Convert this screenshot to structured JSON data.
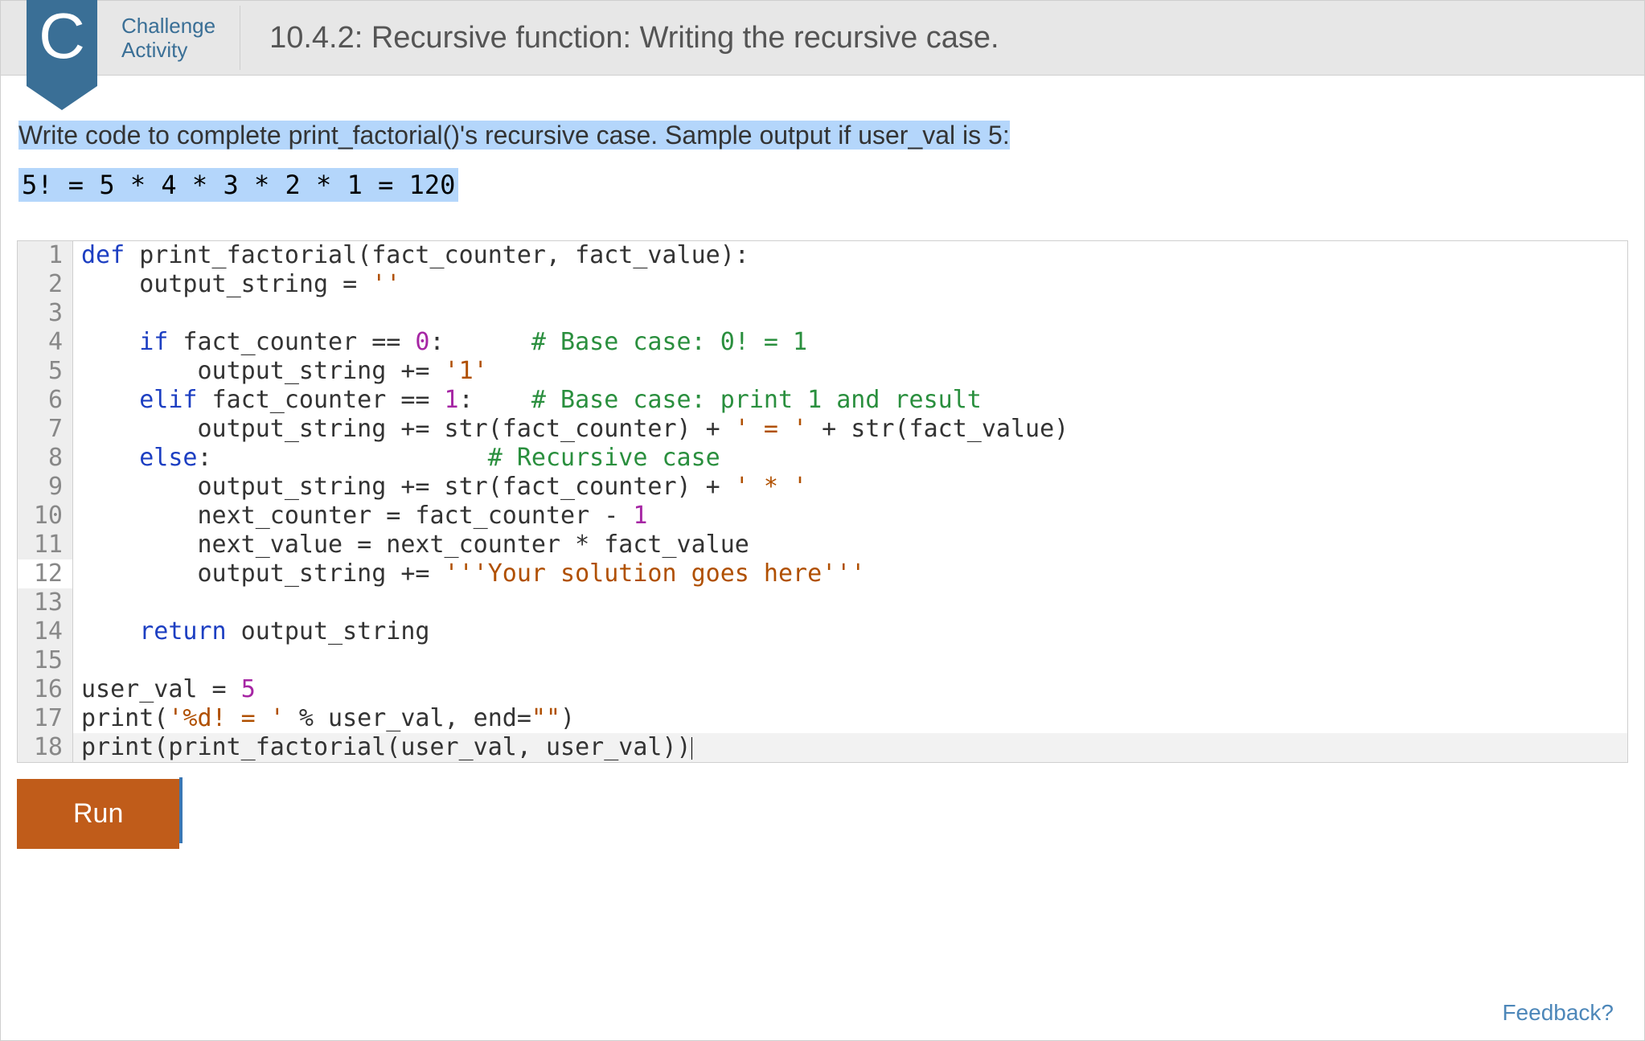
{
  "header": {
    "badge_letter": "C",
    "challenge_line1": "Challenge",
    "challenge_line2": "Activity",
    "title": "10.4.2: Recursive function: Writing the recursive case."
  },
  "instruction": {
    "text": "Write code to complete print_factorial()'s recursive case. Sample output if user_val is 5:",
    "sample_output": "5! = 5 * 4 * 3 * 2 * 1 = 120"
  },
  "code": {
    "lines": [
      {
        "n": 1,
        "tokens": [
          [
            "kw",
            "def"
          ],
          [
            "",
            " "
          ],
          [
            "fn",
            "print_factorial"
          ],
          [
            "",
            "(fact_counter, fact_value):"
          ]
        ]
      },
      {
        "n": 2,
        "tokens": [
          [
            "",
            "    output_string = "
          ],
          [
            "str",
            "''"
          ]
        ]
      },
      {
        "n": 3,
        "tokens": [
          [
            "",
            ""
          ]
        ]
      },
      {
        "n": 4,
        "tokens": [
          [
            "",
            "    "
          ],
          [
            "kw",
            "if"
          ],
          [
            "",
            " fact_counter == "
          ],
          [
            "num",
            "0"
          ],
          [
            "",
            ":      "
          ],
          [
            "com",
            "# Base case: 0! = 1"
          ]
        ]
      },
      {
        "n": 5,
        "tokens": [
          [
            "",
            "        output_string += "
          ],
          [
            "str",
            "'1'"
          ]
        ]
      },
      {
        "n": 6,
        "tokens": [
          [
            "",
            "    "
          ],
          [
            "kw",
            "elif"
          ],
          [
            "",
            " fact_counter == "
          ],
          [
            "num",
            "1"
          ],
          [
            "",
            ":    "
          ],
          [
            "com",
            "# Base case: print 1 and result"
          ]
        ]
      },
      {
        "n": 7,
        "tokens": [
          [
            "",
            "        output_string += str(fact_counter) + "
          ],
          [
            "str",
            "' = '"
          ],
          [
            "",
            " + str(fact_value)"
          ]
        ]
      },
      {
        "n": 8,
        "tokens": [
          [
            "",
            "    "
          ],
          [
            "kw",
            "else"
          ],
          [
            "",
            ":                   "
          ],
          [
            "com",
            "# Recursive case"
          ]
        ]
      },
      {
        "n": 9,
        "tokens": [
          [
            "",
            "        output_string += str(fact_counter) + "
          ],
          [
            "str",
            "' * '"
          ]
        ]
      },
      {
        "n": 10,
        "tokens": [
          [
            "",
            "        next_counter = fact_counter - "
          ],
          [
            "num",
            "1"
          ]
        ]
      },
      {
        "n": 11,
        "tokens": [
          [
            "",
            "        next_value = next_counter * fact_value"
          ]
        ]
      },
      {
        "n": 12,
        "tokens": [
          [
            "",
            "        output_string += "
          ],
          [
            "str",
            "'''Your solution goes here'''"
          ]
        ],
        "current": true
      },
      {
        "n": 13,
        "tokens": [
          [
            "",
            ""
          ]
        ]
      },
      {
        "n": 14,
        "tokens": [
          [
            "",
            "    "
          ],
          [
            "kw",
            "return"
          ],
          [
            "",
            " output_string"
          ]
        ]
      },
      {
        "n": 15,
        "tokens": [
          [
            "",
            ""
          ]
        ]
      },
      {
        "n": 16,
        "tokens": [
          [
            "",
            "user_val = "
          ],
          [
            "num",
            "5"
          ]
        ]
      },
      {
        "n": 17,
        "tokens": [
          [
            "",
            "print("
          ],
          [
            "str",
            "'%d! = '"
          ],
          [
            "",
            " % user_val, end="
          ],
          [
            "str",
            "\"\""
          ],
          [
            "",
            ")"
          ]
        ]
      },
      {
        "n": 18,
        "tokens": [
          [
            "",
            "print(print_factorial(user_val, user_val))"
          ]
        ],
        "alt": true,
        "cursor_after": true
      }
    ]
  },
  "buttons": {
    "run": "Run"
  },
  "feedback_link": "Feedback?"
}
